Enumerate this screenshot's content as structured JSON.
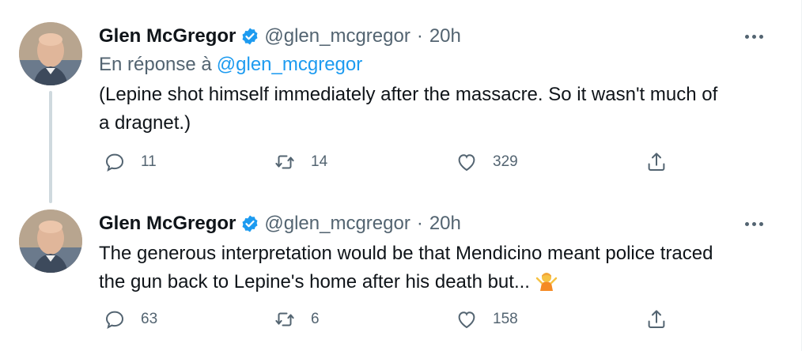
{
  "colors": {
    "verified": "#1d9bf0",
    "mention": "#1d9bf0",
    "secondary_text": "#536471",
    "primary_text": "#0f1419"
  },
  "tweets": [
    {
      "author": {
        "name": "Glen McGregor",
        "handle": "@glen_mcgregor",
        "verified": true
      },
      "separator": "·",
      "time": "20h",
      "reply_prefix": "En réponse à",
      "reply_to": "@glen_mcgregor",
      "text_lines": [
        "(Lepine shot himself immediately after the massacre. So it wasn't much of",
        "a dragnet.)"
      ],
      "stats": {
        "replies": "11",
        "retweets": "14",
        "likes": "329"
      }
    },
    {
      "author": {
        "name": "Glen McGregor",
        "handle": "@glen_mcgregor",
        "verified": true
      },
      "separator": "·",
      "time": "20h",
      "text_lines": [
        "The generous interpretation would be that Mendicino meant police traced",
        "the gun back to Lepine's home after his death but..."
      ],
      "emoji": "person-shrugging-emoji",
      "stats": {
        "replies": "63",
        "retweets": "6",
        "likes": "158"
      }
    }
  ]
}
